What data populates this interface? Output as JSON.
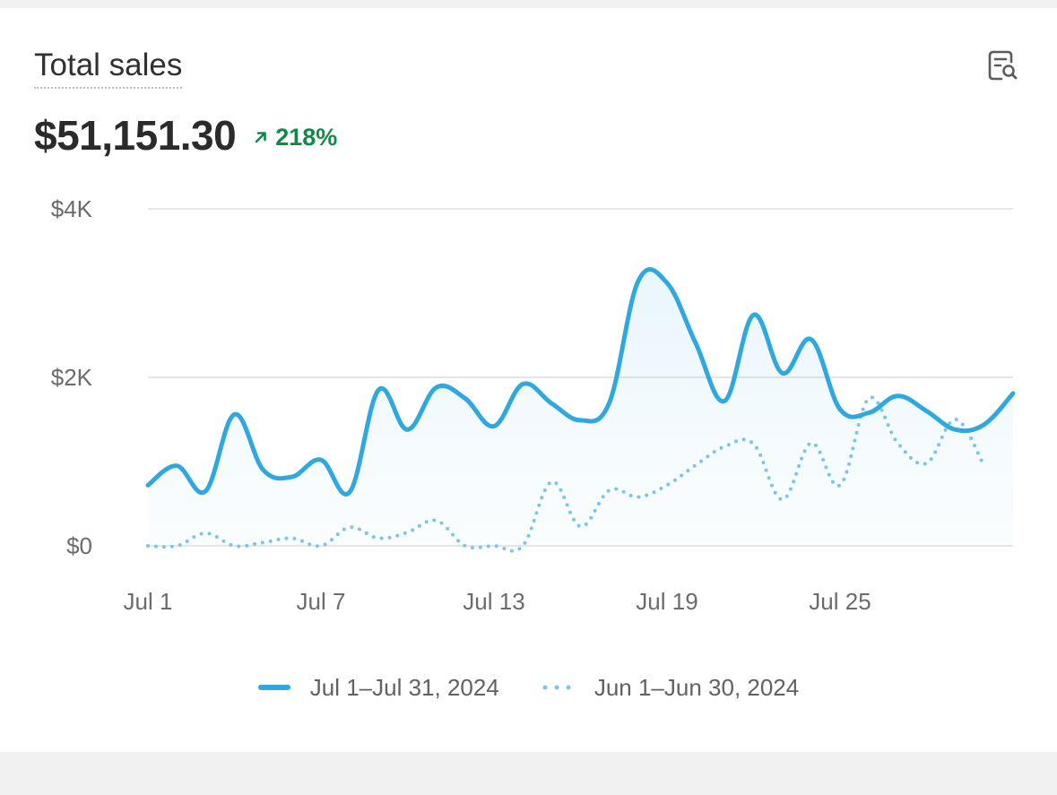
{
  "card": {
    "title": "Total sales",
    "value": "$51,151.30",
    "change": "218%",
    "change_color": "#0f8a4a",
    "icon": "report-search-icon"
  },
  "chart_data": {
    "type": "line",
    "title": "Total sales",
    "yticks": [
      "$0",
      "$2K",
      "$4K"
    ],
    "ylim": [
      0,
      4000
    ],
    "x_tick_labels": [
      "Jul 1",
      "Jul 7",
      "Jul 13",
      "Jul 19",
      "Jul 25"
    ],
    "x_tick_days": [
      1,
      7,
      13,
      19,
      25
    ],
    "grid": true,
    "legend": "bottom",
    "series": [
      {
        "name": "Jul 1–Jul 31, 2024",
        "style": "solid",
        "color": "#2fa8e0",
        "x": [
          1,
          2,
          3,
          4,
          5,
          6,
          7,
          8,
          9,
          10,
          11,
          12,
          13,
          14,
          15,
          16,
          17,
          18,
          19,
          20,
          21,
          22,
          23,
          24,
          25,
          26,
          27,
          28,
          29,
          30,
          31
        ],
        "y": [
          720,
          950,
          650,
          1560,
          900,
          820,
          1020,
          640,
          1850,
          1380,
          1880,
          1750,
          1420,
          1920,
          1690,
          1490,
          1700,
          3140,
          3120,
          2400,
          1720,
          2740,
          2050,
          2450,
          1620,
          1580,
          1780,
          1600,
          1380,
          1440,
          1810
        ]
      },
      {
        "name": "Jun 1–Jun 30, 2024",
        "style": "dotted",
        "color": "#7cc4e8",
        "x": [
          1,
          2,
          3,
          4,
          5,
          6,
          7,
          8,
          9,
          10,
          11,
          12,
          13,
          14,
          15,
          16,
          17,
          18,
          19,
          20,
          21,
          22,
          23,
          24,
          25,
          26,
          27,
          28,
          29,
          30
        ],
        "y": [
          0,
          0,
          150,
          0,
          40,
          90,
          0,
          220,
          90,
          160,
          300,
          0,
          0,
          0,
          760,
          230,
          660,
          580,
          720,
          960,
          1180,
          1210,
          550,
          1220,
          720,
          1750,
          1220,
          980,
          1500,
          950
        ]
      }
    ]
  }
}
